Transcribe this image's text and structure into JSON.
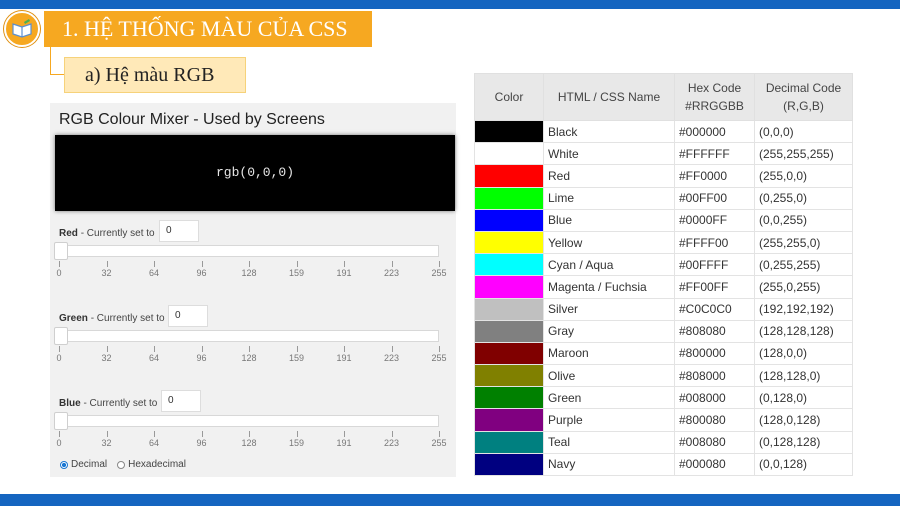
{
  "slide": {
    "title": "1. HỆ THỐNG MÀU CỦA CSS",
    "subtitle": "a) Hệ màu RGB",
    "accent": "#f6a821",
    "bar_color": "#1565c0"
  },
  "mixer": {
    "title": "RGB Colour Mixer - Used by Screens",
    "preview_text": "rgb(0,0,0)",
    "preview_color": "#000000",
    "currently_set_to": "- Currently set to",
    "ticks": [
      "0",
      "32",
      "64",
      "96",
      "128",
      "159",
      "191",
      "223",
      "255"
    ],
    "sliders": [
      {
        "name": "Red",
        "value": "0",
        "level": 0
      },
      {
        "name": "Green",
        "value": "0",
        "level": 0
      },
      {
        "name": "Blue",
        "value": "0",
        "level": 0
      }
    ],
    "radio": {
      "decimal": "Decimal",
      "hexadecimal": "Hexadecimal",
      "selected": "decimal"
    }
  },
  "table": {
    "headers": {
      "color": "Color",
      "name": "HTML / CSS Name",
      "hex_line1": "Hex Code",
      "hex_line2": "#RRGGBB",
      "dec_line1": "Decimal Code",
      "dec_line2": "(R,G,B)"
    },
    "rows": [
      {
        "swatch": "#000000",
        "name": "Black",
        "hex": "#000000",
        "dec": "(0,0,0)"
      },
      {
        "swatch": "#FFFFFF",
        "name": "White",
        "hex": "#FFFFFF",
        "dec": "(255,255,255)"
      },
      {
        "swatch": "#FF0000",
        "name": "Red",
        "hex": "#FF0000",
        "dec": "(255,0,0)"
      },
      {
        "swatch": "#00FF00",
        "name": "Lime",
        "hex": "#00FF00",
        "dec": "(0,255,0)"
      },
      {
        "swatch": "#0000FF",
        "name": "Blue",
        "hex": "#0000FF",
        "dec": "(0,0,255)"
      },
      {
        "swatch": "#FFFF00",
        "name": "Yellow",
        "hex": "#FFFF00",
        "dec": "(255,255,0)"
      },
      {
        "swatch": "#00FFFF",
        "name": "Cyan / Aqua",
        "hex": "#00FFFF",
        "dec": "(0,255,255)"
      },
      {
        "swatch": "#FF00FF",
        "name": "Magenta / Fuchsia",
        "hex": "#FF00FF",
        "dec": "(255,0,255)"
      },
      {
        "swatch": "#C0C0C0",
        "name": "Silver",
        "hex": "#C0C0C0",
        "dec": "(192,192,192)"
      },
      {
        "swatch": "#808080",
        "name": "Gray",
        "hex": "#808080",
        "dec": "(128,128,128)"
      },
      {
        "swatch": "#800000",
        "name": "Maroon",
        "hex": "#800000",
        "dec": "(128,0,0)"
      },
      {
        "swatch": "#808000",
        "name": "Olive",
        "hex": "#808000",
        "dec": "(128,128,0)"
      },
      {
        "swatch": "#008000",
        "name": "Green",
        "hex": "#008000",
        "dec": "(0,128,0)"
      },
      {
        "swatch": "#800080",
        "name": "Purple",
        "hex": "#800080",
        "dec": "(128,0,128)"
      },
      {
        "swatch": "#008080",
        "name": "Teal",
        "hex": "#008080",
        "dec": "(0,128,128)"
      },
      {
        "swatch": "#000080",
        "name": "Navy",
        "hex": "#000080",
        "dec": "(0,0,128)"
      }
    ]
  }
}
